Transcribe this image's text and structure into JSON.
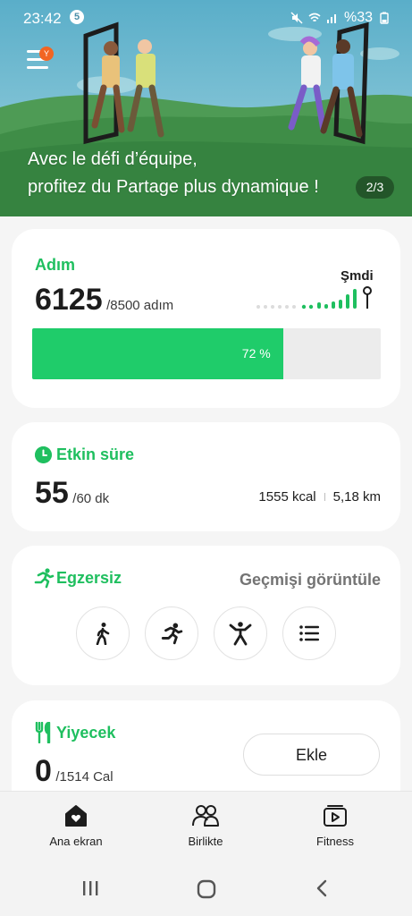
{
  "status_bar": {
    "time": "23:42",
    "notification_count": "5",
    "battery": "%33"
  },
  "banner": {
    "notification_badge": "Y",
    "line1": "Avec le défi d’équipe,",
    "line2": "profitez du Partage plus dynamique !",
    "page_indicator": "2/3"
  },
  "steps": {
    "title": "Adım",
    "count": "6125",
    "goal": "/8500 adım",
    "now_label": "Şmdi",
    "progress_percent": 72,
    "progress_label": "72 %"
  },
  "active_time": {
    "title": "Etkin süre",
    "minutes": "55",
    "goal": "/60 dk",
    "calories": "1555 kcal",
    "distance": "5,18 km"
  },
  "exercise": {
    "title": "Egzersiz",
    "history_link": "Geçmişi görüntüle",
    "buttons": [
      "walking-icon",
      "running-icon",
      "workout-icon",
      "list-icon"
    ]
  },
  "food": {
    "title": "Yiyecek",
    "value": "0",
    "goal": "/1514 Cal",
    "add_button": "Ekle"
  },
  "bottom_nav": {
    "items": [
      {
        "label": "Ana ekran",
        "icon": "home-heart-icon"
      },
      {
        "label": "Birlikte",
        "icon": "people-icon"
      },
      {
        "label": "Fitness",
        "icon": "fitness-video-icon"
      }
    ]
  },
  "colors": {
    "accent": "#1fbf5f",
    "progress_fill": "#1fcc6a",
    "banner_green": "#3f9d4a"
  }
}
